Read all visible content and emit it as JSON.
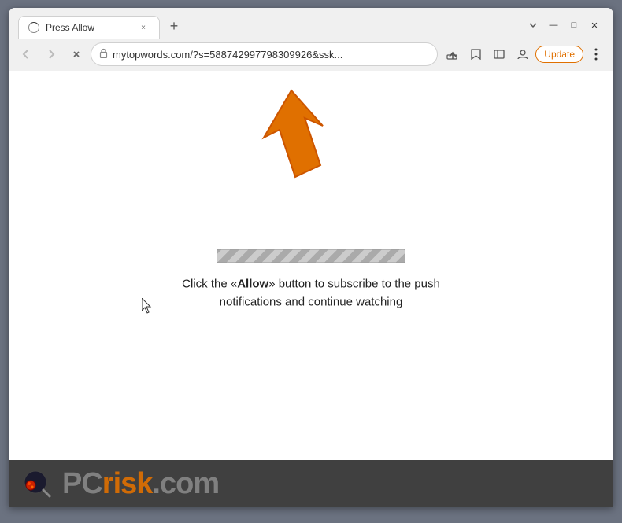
{
  "browser": {
    "tab": {
      "favicon_alt": "loading",
      "title": "Press Allow",
      "close_label": "×"
    },
    "new_tab_label": "+",
    "window_controls": {
      "minimize": "—",
      "maximize": "□",
      "close": "✕"
    },
    "nav": {
      "back_label": "←",
      "forward_label": "→",
      "reload_label": "✕"
    },
    "address_bar": {
      "lock_icon": "🔒",
      "url": "mytopwords.com/?s=588742997798309926&ssk..."
    },
    "toolbar_actions": {
      "share_label": "⬆",
      "bookmark_label": "☆",
      "sidebar_label": "▭",
      "profile_label": "👤",
      "update_label": "Update",
      "more_label": "⋮"
    }
  },
  "page": {
    "instruction_part1": "Click the «",
    "instruction_allow": "Allow",
    "instruction_part2": "» button to subscribe to the push notifications and continue watching"
  },
  "watermark": {
    "brand_pc": "PC",
    "brand_risk": "risk",
    "brand_com": ".com"
  }
}
